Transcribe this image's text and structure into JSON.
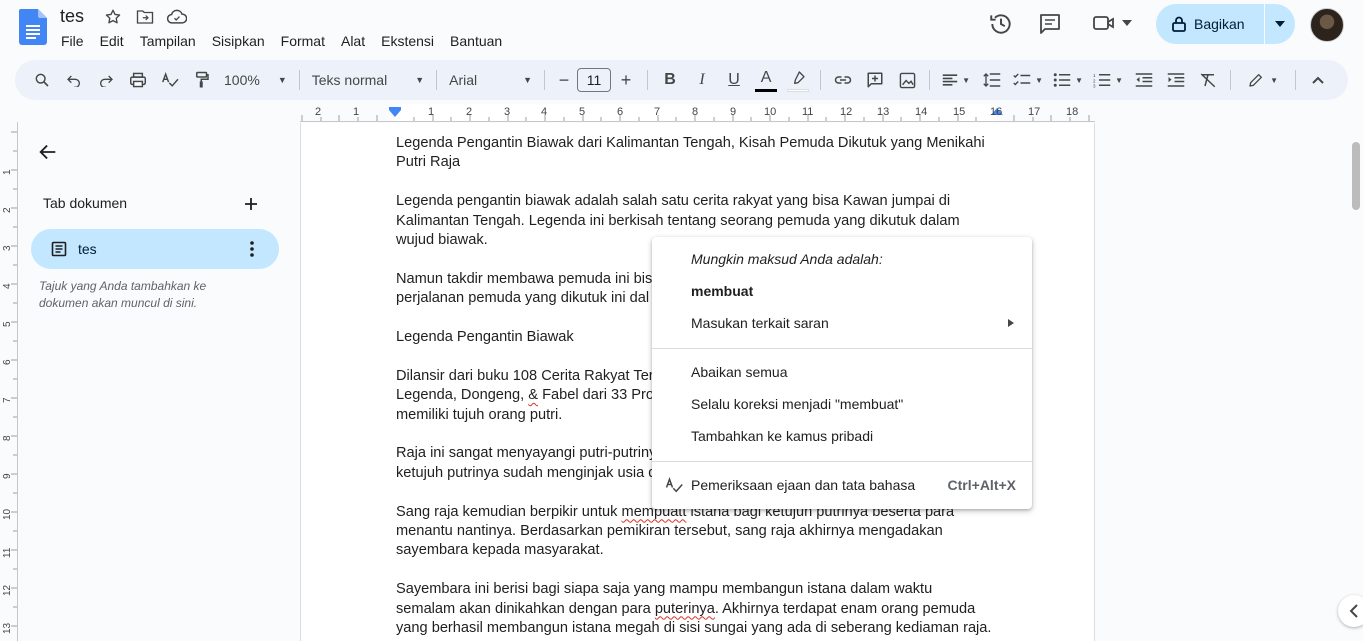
{
  "header": {
    "doc_title": "tes",
    "menu": [
      "File",
      "Edit",
      "Tampilan",
      "Sisipkan",
      "Format",
      "Alat",
      "Ekstensi",
      "Bantuan"
    ],
    "share_label": "Bagikan"
  },
  "toolbar": {
    "zoom": "100%",
    "style": "Teks normal",
    "font": "Arial",
    "font_size": "11",
    "minus": "−",
    "plus": "+",
    "bold": "B",
    "italic": "I",
    "underline": "U",
    "text_color": "A",
    "text_color_hex": "#000000",
    "highlight_hex": "#ffffff"
  },
  "ruler": {
    "numbers": [
      "2",
      "1",
      "1",
      "1",
      "2",
      "3",
      "4",
      "5",
      "6",
      "7",
      "8",
      "9",
      "10",
      "11",
      "12",
      "13",
      "14",
      "15",
      "16",
      "17",
      "18"
    ],
    "left_numbers": [
      "1",
      "1",
      "2",
      "3",
      "4",
      "5",
      "6",
      "7",
      "8",
      "9",
      "10",
      "11",
      "12",
      "13"
    ]
  },
  "sidebar": {
    "tabs_heading": "Tab dokumen",
    "tab_label": "tes",
    "hint": "Tajuk yang Anda tambahkan ke dokumen akan muncul di sini."
  },
  "document": {
    "p1_a": "Legenda Pengantin Biawak dari Kalimantan Tengah, Kisah Pemuda Dikutuk yang Menikahi",
    "p1_b": "Putri Raja",
    "p2_a": "Legenda pengantin biawak adalah salah satu cerita rakyat yang bisa Kawan jumpai di",
    "p2_b": "Kalimantan Tengah. Legenda ini berkisah tentang seorang pemuda yang dikutuk dalam",
    "p2_c": "wujud biawak.",
    "p3_a": "Namun takdir membawa pemuda ini bis",
    "p3_b": "perjalanan pemuda yang dikutuk ini dal",
    "p4": "Legenda Pengantin Biawak",
    "p5_a": "Dilansir dari buku 108 Cerita Rakyat Ter",
    "p5_b1": "Legenda, Dongeng, ",
    "p5_b2": "&",
    "p5_b3": " Fabel dari 33 Pro",
    "p5_c": "memiliki tujuh orang putri.",
    "p6_a": "Raja ini sangat menyayangi putri-putriny",
    "p6_b": "ketujuh putrinya sudah menginjak usia d",
    "p7_a1": "Sang raja kemudian berpikir untuk ",
    "p7_a2": "mempuatt",
    "p7_a3": " istana bagi ketujuh putrinya beserta para",
    "p7_b": "menantu nantinya. Berdasarkan pemikiran tersebut, sang raja akhirnya mengadakan",
    "p7_c": "sayembara kepada masyarakat.",
    "p8_a": "Sayembara ini berisi bagi siapa saja yang mampu membangun istana dalam waktu",
    "p8_b1": "semalam akan dinikahkan dengan para ",
    "p8_b2": "puterinya",
    "p8_b3": ". Akhirnya terdapat enam orang pemuda",
    "p8_c": "yang berhasil membangun istana megah di sisi sungai yang ada di seberang kediaman raja."
  },
  "context_menu": {
    "suggest_heading": "Mungkin maksud Anda adalah:",
    "suggestion": "membuat",
    "feedback": "Masukan terkait saran",
    "ignore_all": "Abaikan semua",
    "always_correct": "Selalu koreksi menjadi \"membuat\"",
    "add_dictionary": "Tambahkan ke kamus pribadi",
    "spellcheck": "Pemeriksaan ejaan dan tata bahasa",
    "spellcheck_shortcut": "Ctrl+Alt+X"
  }
}
